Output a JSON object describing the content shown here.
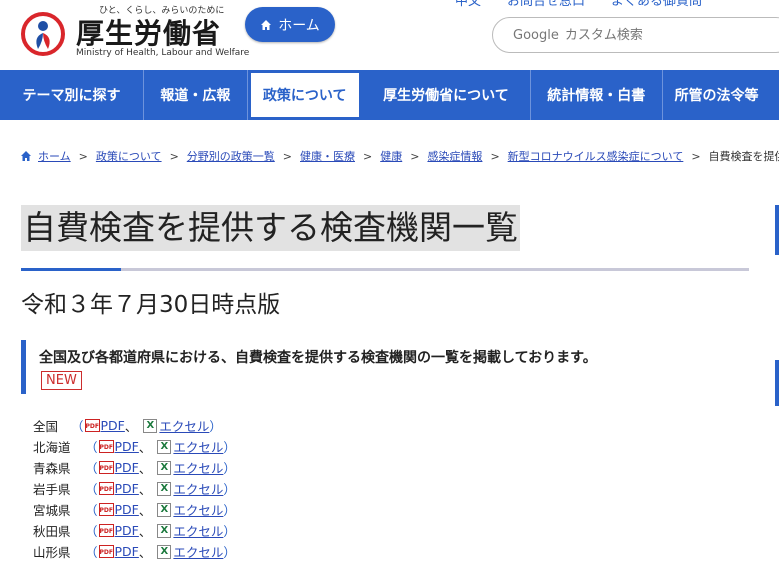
{
  "header": {
    "tagline": "ひと、くらし、みらいのために",
    "org_name": "厚生労働省",
    "org_name_en": "Ministry of Health, Labour and Welfare",
    "home_button": "ホーム",
    "top_links": "中文　　お問合せ窓口　　よくある御質問",
    "search_brand": "Google",
    "search_placeholder": "カスタム検索"
  },
  "nav": {
    "items": [
      {
        "label": "テーマ別に探す"
      },
      {
        "label": "報道・広報"
      },
      {
        "label": "政策について"
      },
      {
        "label": "厚生労働省について"
      },
      {
        "label": "統計情報・白書"
      },
      {
        "label": "所管の法令等"
      }
    ]
  },
  "breadcrumb": {
    "items": [
      "ホーム",
      "政策について",
      "分野別の政策一覧",
      "健康・医療",
      "健康",
      "感染症情報",
      "新型コロナウイルス感染症について"
    ],
    "current": "自費検査を提供",
    "separator": ">"
  },
  "page": {
    "title": "自費検査を提供する検査機関一覧",
    "subtitle": "令和３年７月30日時点版",
    "notice": "全国及び各都道府県における、自費検査を提供する検査機関の一覧を掲載しております。",
    "badge": "NEW"
  },
  "list": {
    "pdf_label": "PDF",
    "excel_label": "エクセル",
    "pdf_icon_text": "PDF",
    "excel_icon_text": "X",
    "open_paren": "（",
    "close_paren": "）",
    "comma": "、",
    "rows": [
      {
        "name": "全国"
      },
      {
        "name": "北海道"
      },
      {
        "name": "青森県"
      },
      {
        "name": "岩手県"
      },
      {
        "name": "宮城県"
      },
      {
        "name": "秋田県"
      },
      {
        "name": "山形県"
      }
    ]
  },
  "colors": {
    "brand_blue": "#2a62c9",
    "new_badge": "#cc2d2d"
  }
}
